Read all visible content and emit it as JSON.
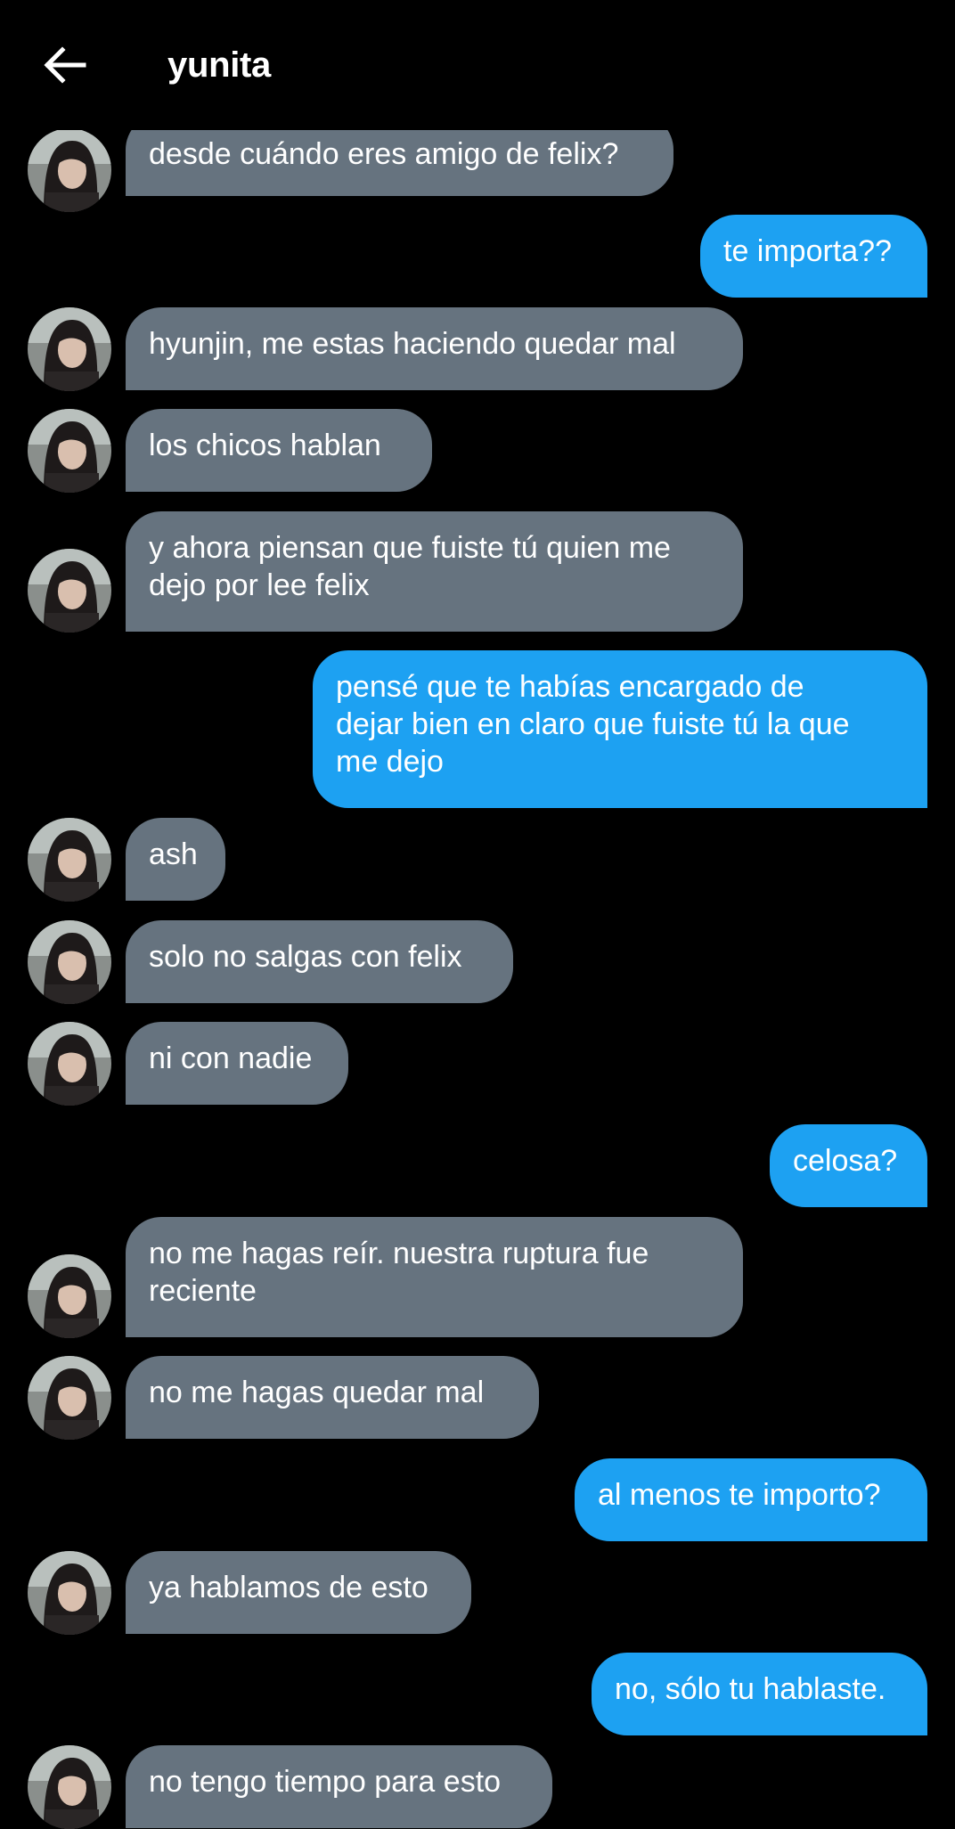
{
  "header": {
    "title": "yunita",
    "back_icon": "arrow-left-icon"
  },
  "contact": {
    "avatar_icon": "contact-avatar"
  },
  "colors": {
    "background": "#000000",
    "incoming_bubble": "#66737f",
    "outgoing_bubble": "#1da1f2",
    "text": "#ffffff"
  },
  "messages": [
    {
      "sender": "them",
      "text": "desde cuándo eres amigo de felix?"
    },
    {
      "sender": "me",
      "text": "te importa??"
    },
    {
      "sender": "them",
      "text": "hyunjin, me estas haciendo quedar mal"
    },
    {
      "sender": "them",
      "text": "los chicos hablan"
    },
    {
      "sender": "them",
      "lines": [
        "y ahora piensan que fuiste tú quien me",
        "dejo por lee felix"
      ]
    },
    {
      "sender": "me",
      "lines": [
        "pensé que te habías encargado de",
        "dejar bien en claro que fuiste tú la que",
        "me dejo"
      ]
    },
    {
      "sender": "them",
      "text": "ash"
    },
    {
      "sender": "them",
      "text": "solo no salgas con felix"
    },
    {
      "sender": "them",
      "text": "ni con nadie"
    },
    {
      "sender": "me",
      "text": "celosa?"
    },
    {
      "sender": "them",
      "lines": [
        "no me hagas reír. nuestra ruptura fue",
        "reciente"
      ]
    },
    {
      "sender": "them",
      "text": "no me hagas quedar mal"
    },
    {
      "sender": "me",
      "text": "al menos te importo?"
    },
    {
      "sender": "them",
      "text": "ya hablamos de esto"
    },
    {
      "sender": "me",
      "text": "no, sólo tu hablaste."
    },
    {
      "sender": "them",
      "text": "no tengo tiempo para esto"
    }
  ]
}
